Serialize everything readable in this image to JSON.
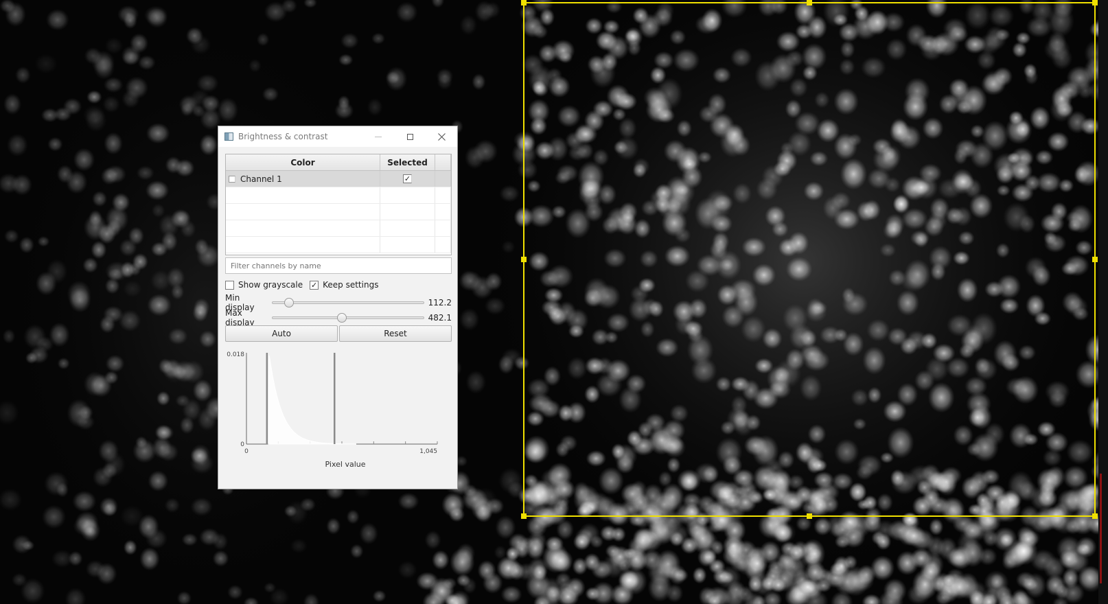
{
  "dialog": {
    "title": "Brightness & contrast",
    "table": {
      "headers": {
        "color": "Color",
        "selected": "Selected"
      },
      "rows": [
        {
          "name": "Channel 1",
          "selected_mark": "✓"
        }
      ]
    },
    "filter": {
      "placeholder": "Filter channels by name",
      "value": ""
    },
    "options": {
      "show_grayscale": {
        "label": "Show grayscale",
        "checked": false
      },
      "keep_settings": {
        "label": "Keep settings",
        "checked": true,
        "mark": "✓"
      }
    },
    "min_display": {
      "label": "Min display",
      "value": "112.2",
      "fraction": 0.107
    },
    "max_display": {
      "label": "Max display",
      "value": "482.1",
      "fraction": 0.46
    },
    "buttons": {
      "auto": "Auto",
      "reset": "Reset"
    },
    "histogram": {
      "y_max_label": "0.018",
      "y_min_label": "0",
      "x_min_label": "0",
      "x_max_label": "1,045",
      "xlabel": "Pixel value",
      "min_line_value": 112.2,
      "max_line_value": 482.1
    }
  },
  "colors": {
    "roi": "#f0e000",
    "background": "#050505"
  }
}
